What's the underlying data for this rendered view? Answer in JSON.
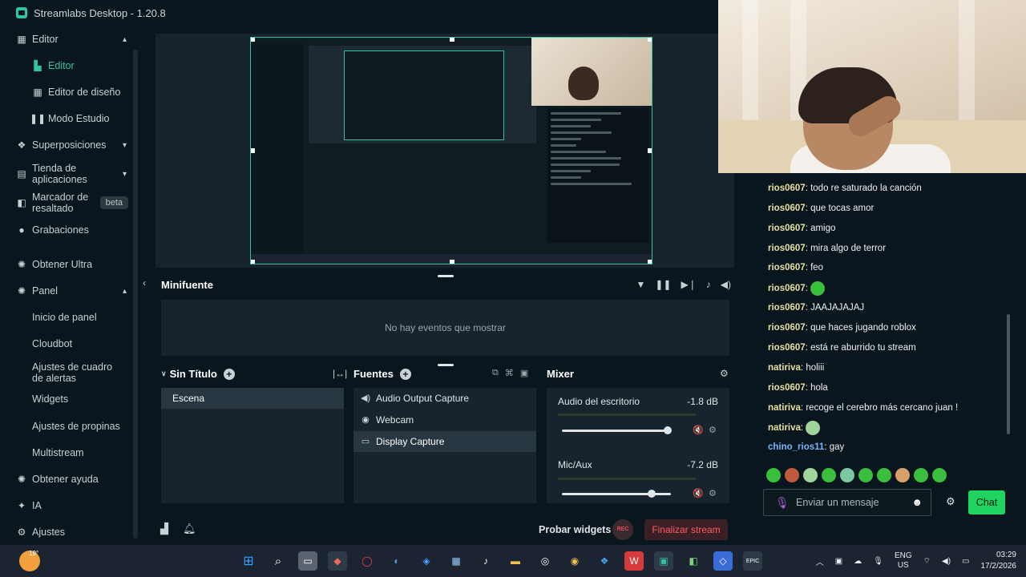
{
  "window": {
    "title": "Streamlabs Desktop - 1.20.8"
  },
  "sidebar": {
    "items": [
      {
        "label": "Editor",
        "icon": "editor-icon",
        "chevron": "▴"
      },
      {
        "label": "Editor",
        "icon": "editor-icon",
        "active": true
      },
      {
        "label": "Editor de diseño",
        "icon": "layout-icon"
      },
      {
        "label": "Modo Estudio",
        "icon": "studio-icon"
      },
      {
        "label": "Superposiciones",
        "icon": "overlays-icon",
        "chevron": "▾"
      },
      {
        "label": "Tienda de aplicaciones",
        "icon": "store-icon",
        "chevron": "▾"
      },
      {
        "label": "Marcador de resaltado",
        "icon": "highlighter-icon",
        "badge": "beta"
      },
      {
        "label": "Grabaciones",
        "icon": "recordings-icon"
      },
      {
        "label": "Obtener Ultra",
        "icon": "ultra-icon"
      },
      {
        "label": "Panel",
        "icon": "dashboard-icon",
        "chevron": "▴"
      },
      {
        "label": "Inicio de panel"
      },
      {
        "label": "Cloudbot"
      },
      {
        "label": "Ajustes de cuadro de alertas"
      },
      {
        "label": "Widgets"
      },
      {
        "label": "Ajustes de propinas"
      },
      {
        "label": "Multistream"
      },
      {
        "label": "Obtener ayuda",
        "icon": "help-icon"
      },
      {
        "label": "IA",
        "icon": "ai-icon"
      },
      {
        "label": "Ajustes",
        "icon": "settings-icon"
      }
    ]
  },
  "minifuente": {
    "title": "Minifuente",
    "empty_text": "No hay eventos que mostrar"
  },
  "scenes": {
    "title": "Sin Título",
    "items": [
      "Escena"
    ]
  },
  "sources": {
    "title": "Fuentes",
    "items": [
      {
        "label": "Audio Output Capture",
        "icon": "speaker-icon"
      },
      {
        "label": "Webcam",
        "icon": "webcam-icon"
      },
      {
        "label": "Display Capture",
        "icon": "monitor-icon",
        "selected": true
      }
    ]
  },
  "mixer": {
    "title": "Mixer",
    "channels": [
      {
        "name": "Audio del escritorio",
        "db": "-1.8 dB",
        "volume": 0.97
      },
      {
        "name": "Mic/Aux",
        "db": "-7.2 dB",
        "volume": 0.82
      }
    ]
  },
  "footer": {
    "test_widgets": "Probar widgets",
    "rec": "REC",
    "end_stream": "Finalizar stream"
  },
  "chat": {
    "messages": [
      {
        "user": "rios0607",
        "text": "todo re saturado la canción"
      },
      {
        "user": "rios0607",
        "text": "que tocas amor"
      },
      {
        "user": "rios0607",
        "text": "amigo"
      },
      {
        "user": "rios0607",
        "text": "mira algo de terror"
      },
      {
        "user": "rios0607",
        "text": "feo"
      },
      {
        "user": "rios0607",
        "text": "",
        "emote": "green-emote"
      },
      {
        "user": "rios0607",
        "text": "JAAJAJAJAJ"
      },
      {
        "user": "rios0607",
        "text": "que haces jugando roblox"
      },
      {
        "user": "rios0607",
        "text": "está re aburrido tu stream"
      },
      {
        "user": "natiriva",
        "text": "holiii"
      },
      {
        "user": "rios0607",
        "text": "hola"
      },
      {
        "user": "natiriva",
        "text": "recoge el cerebro más cercano juan !"
      },
      {
        "user": "natiriva",
        "text": "",
        "emote": "skull-emote"
      },
      {
        "user": "chino_rios11",
        "text": "gay",
        "blue": true
      }
    ],
    "input_placeholder": "Enviar un mensaje",
    "send_label": "Chat"
  },
  "taskbar": {
    "temperature": "19°",
    "lang": "ENG",
    "region": "US",
    "time": "03:29",
    "date": "17/2/2026"
  }
}
